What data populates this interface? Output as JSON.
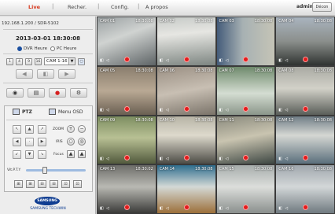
{
  "nav": {
    "items": [
      "Live",
      "Recher.",
      "Config.",
      "A propos"
    ],
    "user": "admin",
    "logout": "Décon"
  },
  "left": {
    "ip": "192.168.1.200 / SDR-5102",
    "datetime": "2013-03-01 18:30:08",
    "radio_dvr": "DVR Heure",
    "radio_pc": "PC Heure",
    "split_buttons": [
      "1",
      "4",
      "9",
      "16"
    ],
    "camera_select": "CAM 1-16",
    "ptz_tab": "PTZ",
    "menu_tab": "Menu OSD",
    "zoom_label": "ZOOM",
    "iris_label": "IRIS",
    "focus_label": "Focus",
    "speed_label": "Vit.P.T.Y",
    "brand": "SAMSUNG",
    "brand_sub": "SAMSUNG TECHWIN"
  },
  "cameras": [
    {
      "name": "CAM 01",
      "time": "18:30:08",
      "bg": "linear-gradient(160deg,#9aa0a2 0%,#d0d3d1 40%,#5e6466 100%)"
    },
    {
      "name": "CAM 02",
      "time": "18:30:08",
      "bg": "linear-gradient(175deg,#c6cac7 0%,#e6e6e2 35%,#7d8581 100%)"
    },
    {
      "name": "CAM 03",
      "time": "18:30:08",
      "bg": "linear-gradient(90deg,#445c7a 0%,#a7b1b3 45%,#c5c4b6 100%)"
    },
    {
      "name": "CAM 04",
      "time": "18:30:08",
      "bg": "linear-gradient(180deg,#aab4bf 0%,#8b8f8c 50%,#2f3331 100%)"
    },
    {
      "name": "CAM 05",
      "time": "18:30:08",
      "bg": "linear-gradient(180deg,#8a7e6e 0%,#b9a994 50%,#6a5f52 100%)"
    },
    {
      "name": "CAM 06",
      "time": "18:30:08",
      "bg": "linear-gradient(170deg,#9a8f83 0%,#c8bfb3 50%,#7a7369 100%)"
    },
    {
      "name": "CAM 07",
      "time": "18:30:08",
      "bg": "linear-gradient(180deg,#6f8a6c 0%,#d4ddd2 55%,#8b968a 100%)"
    },
    {
      "name": "CAM 08",
      "time": "18:30:08",
      "bg": "linear-gradient(180deg,#a9aaa3 0%,#d2d1c8 45%,#5a5e59 100%)"
    },
    {
      "name": "CAM 09",
      "time": "18:30:08",
      "bg": "linear-gradient(180deg,#7d8e61 0%,#b8c094 45%,#525a3d 100%)"
    },
    {
      "name": "CAM 10",
      "time": "18:30:08",
      "bg": "linear-gradient(180deg,#b7b4a6 0%,#ddd9cc 40%,#4d4c46 100%)"
    },
    {
      "name": "CAM 11",
      "time": "18:30:08",
      "bg": "linear-gradient(170deg,#8a8a7d 0%,#c9c4b0 45%,#3e4743 100%)"
    },
    {
      "name": "CAM 12",
      "time": "18:30:08",
      "bg": "linear-gradient(180deg,#6f7d86 0%,#d5d7d3 40%,#5b6f7c 100%)"
    },
    {
      "name": "CAM 13",
      "time": "18:30:02",
      "bg": "linear-gradient(180deg,#6d6d69 0%,#b9b9b3 45%,#3a3a38 100%)"
    },
    {
      "name": "CAM 14",
      "time": "18:30:08",
      "bg": "linear-gradient(180deg,#2f6e8f 0%,#d4d9d6 45%,#9c6f3a 100%)"
    },
    {
      "name": "CAM 15",
      "time": "18:30:08",
      "bg": "linear-gradient(180deg,#a7adac 0%,#dcdedb 45%,#8a8f8d 100%)"
    },
    {
      "name": "CAM 16",
      "time": "18:30:08",
      "bg": "linear-gradient(180deg,#a0a7ad 0%,#d3d7d8 45%,#707a80 100%)"
    }
  ]
}
